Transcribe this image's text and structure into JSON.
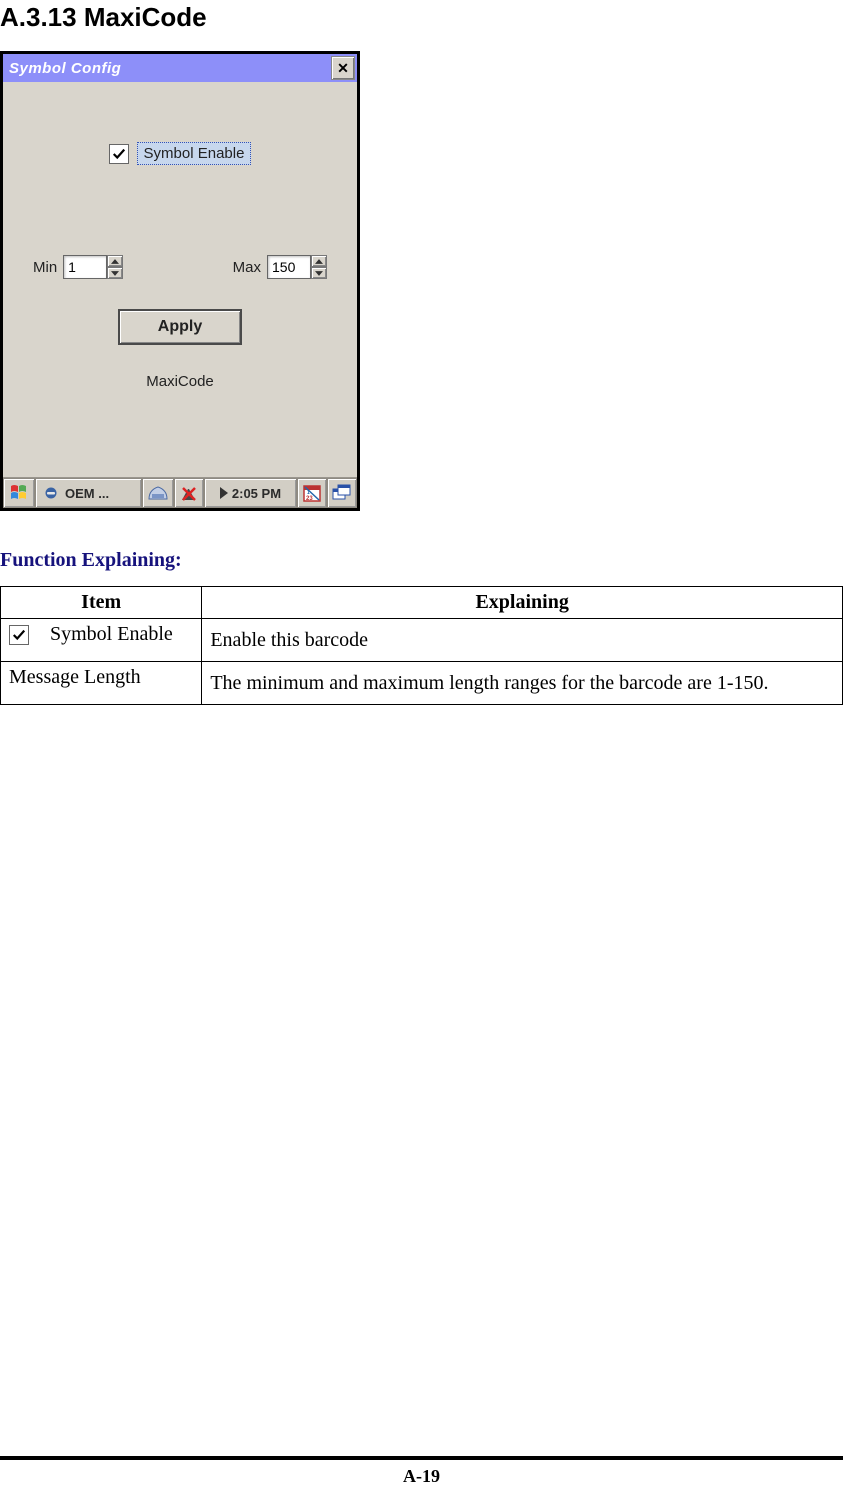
{
  "heading": "A.3.13 MaxiCode",
  "window": {
    "title": "Symbol Config",
    "checkbox": {
      "label": "Symbol Enable",
      "checked": true
    },
    "min": {
      "label": "Min",
      "value": "1"
    },
    "max": {
      "label": "Max",
      "value": "150"
    },
    "apply_label": "Apply",
    "code_label": "MaxiCode"
  },
  "taskbar": {
    "oem": "OEM ...",
    "time": "2:05 PM"
  },
  "function_heading": "Function Explaining:",
  "table": {
    "headers": {
      "item": "Item",
      "explaining": "Explaining"
    },
    "rows": [
      {
        "item": "Symbol Enable",
        "explaining": "Enable this barcode",
        "has_checkbox": true
      },
      {
        "item": "Message Length",
        "explaining": "The minimum and maximum length ranges for the barcode are 1-150.",
        "has_checkbox": false
      }
    ]
  },
  "page_number": "A-19"
}
